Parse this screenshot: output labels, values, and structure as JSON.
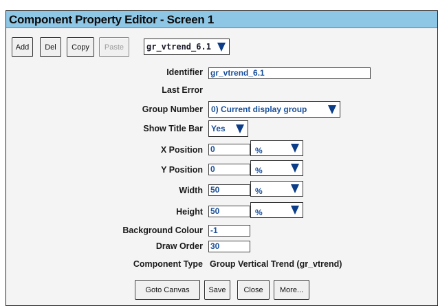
{
  "window": {
    "title": "Component Property Editor - Screen 1"
  },
  "toolbar": {
    "add": "Add",
    "del": "Del",
    "copy": "Copy",
    "paste": "Paste",
    "component_select": "gr_vtrend_6.1"
  },
  "form": {
    "identifier": {
      "label": "Identifier",
      "value": "gr_vtrend_6.1"
    },
    "last_error": {
      "label": "Last Error",
      "value": ""
    },
    "group_number": {
      "label": "Group Number",
      "value": "0) Current display group"
    },
    "show_title_bar": {
      "label": "Show Title Bar",
      "value": "Yes"
    },
    "x_position": {
      "label": "X Position",
      "value": "0",
      "unit": "%"
    },
    "y_position": {
      "label": "Y Position",
      "value": "0",
      "unit": "%"
    },
    "width": {
      "label": "Width",
      "value": "50",
      "unit": "%"
    },
    "height": {
      "label": "Height",
      "value": "50",
      "unit": "%"
    },
    "background_colour": {
      "label": "Background Colour",
      "value": "-1"
    },
    "draw_order": {
      "label": "Draw Order",
      "value": "30"
    },
    "component_type": {
      "label": "Component Type",
      "value": "Group Vertical Trend (gr_vtrend)"
    }
  },
  "footer": {
    "goto_canvas": "Goto Canvas",
    "save": "Save",
    "close": "Close",
    "more": "More..."
  },
  "colors": {
    "titlebar": "#8ec6e6",
    "value_text": "#1a4f9a",
    "arrow": "#0c3d88"
  }
}
